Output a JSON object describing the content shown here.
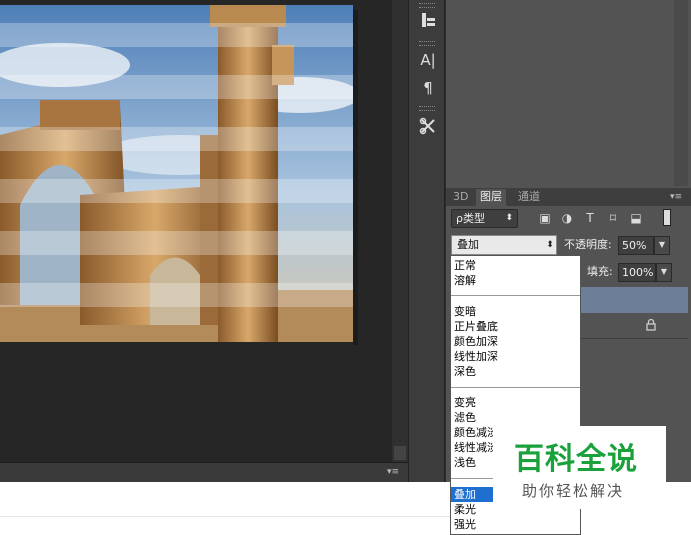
{
  "tool_strip": {
    "icons": [
      "layer-comps-icon",
      "character-icon",
      "paragraph-icon",
      "tool-presets-icon"
    ],
    "char_glyph": "A|",
    "para_glyph": "¶"
  },
  "layers_panel": {
    "tabs": [
      "3D",
      "图层",
      "通道"
    ],
    "kind_filter": "ρ类型",
    "kind_arrow": "⬍",
    "filter_icons": [
      "pixel-filter-icon",
      "adjustment-filter-icon",
      "type-filter-icon",
      "shape-filter-icon",
      "smart-object-filter-icon"
    ],
    "filter_glyphs": [
      "▣",
      "◑",
      "T",
      "⌑",
      "⬓"
    ],
    "blend_mode": "叠加",
    "blend_arrow": "⬍",
    "opacity_label": "不透明度:",
    "opacity_value": "50%",
    "fill_label": "填充:",
    "fill_value": "100%",
    "menu_glyph": "▾≡",
    "lock_glyph": "🔒"
  },
  "blend_dropdown": {
    "groups": [
      [
        "正常",
        "溶解"
      ],
      [
        "变暗",
        "正片叠底",
        "颜色加深",
        "线性加深",
        "深色"
      ],
      [
        "变亮",
        "滤色",
        "颜色减淡",
        "线性减淡",
        "浅色"
      ],
      [
        "叠加",
        "柔光",
        "强光"
      ]
    ],
    "selected": "叠加"
  },
  "status_bar": {
    "menu_glyph": "▾≡"
  },
  "watermark": {
    "title": "百科全说",
    "subtitle": "助你轻松解决"
  },
  "colors": {
    "panel_bg": "#535353",
    "selected_layer": "#6d7f98",
    "dropdown_highlight": "#1e6fd0",
    "watermark_green": "#1ba13c"
  }
}
